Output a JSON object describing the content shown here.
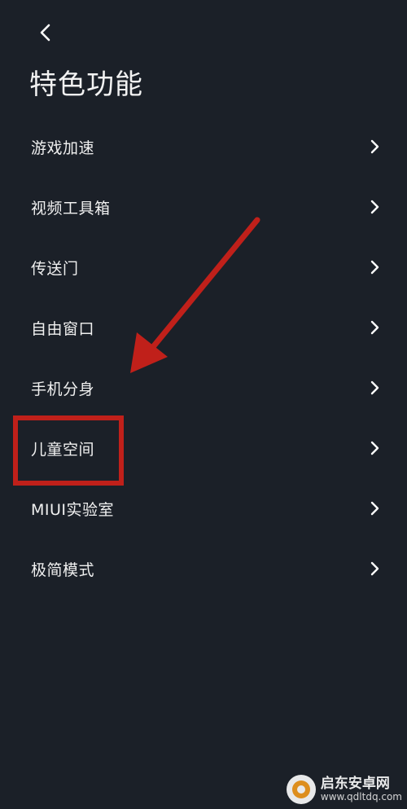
{
  "header": {
    "back_icon": "chevron-left-icon",
    "title": "特色功能"
  },
  "menu": {
    "items": [
      {
        "label": "游戏加速",
        "icon": "chevron-right-icon"
      },
      {
        "label": "视频工具箱",
        "icon": "chevron-right-icon"
      },
      {
        "label": "传送门",
        "icon": "chevron-right-icon"
      },
      {
        "label": "自由窗口",
        "icon": "chevron-right-icon"
      },
      {
        "label": "手机分身",
        "icon": "chevron-right-icon"
      },
      {
        "label": "儿童空间",
        "icon": "chevron-right-icon"
      },
      {
        "label": "MIUI实验室",
        "icon": "chevron-right-icon"
      },
      {
        "label": "极简模式",
        "icon": "chevron-right-icon"
      }
    ]
  },
  "annotations": {
    "highlight_color": "#c0201a",
    "highlighted_item": "儿童空间"
  },
  "watermark": {
    "title": "启东安卓网",
    "url": "www.qdltdq.com"
  },
  "colors": {
    "background": "#1b2028",
    "text": "#f0f0f0"
  }
}
